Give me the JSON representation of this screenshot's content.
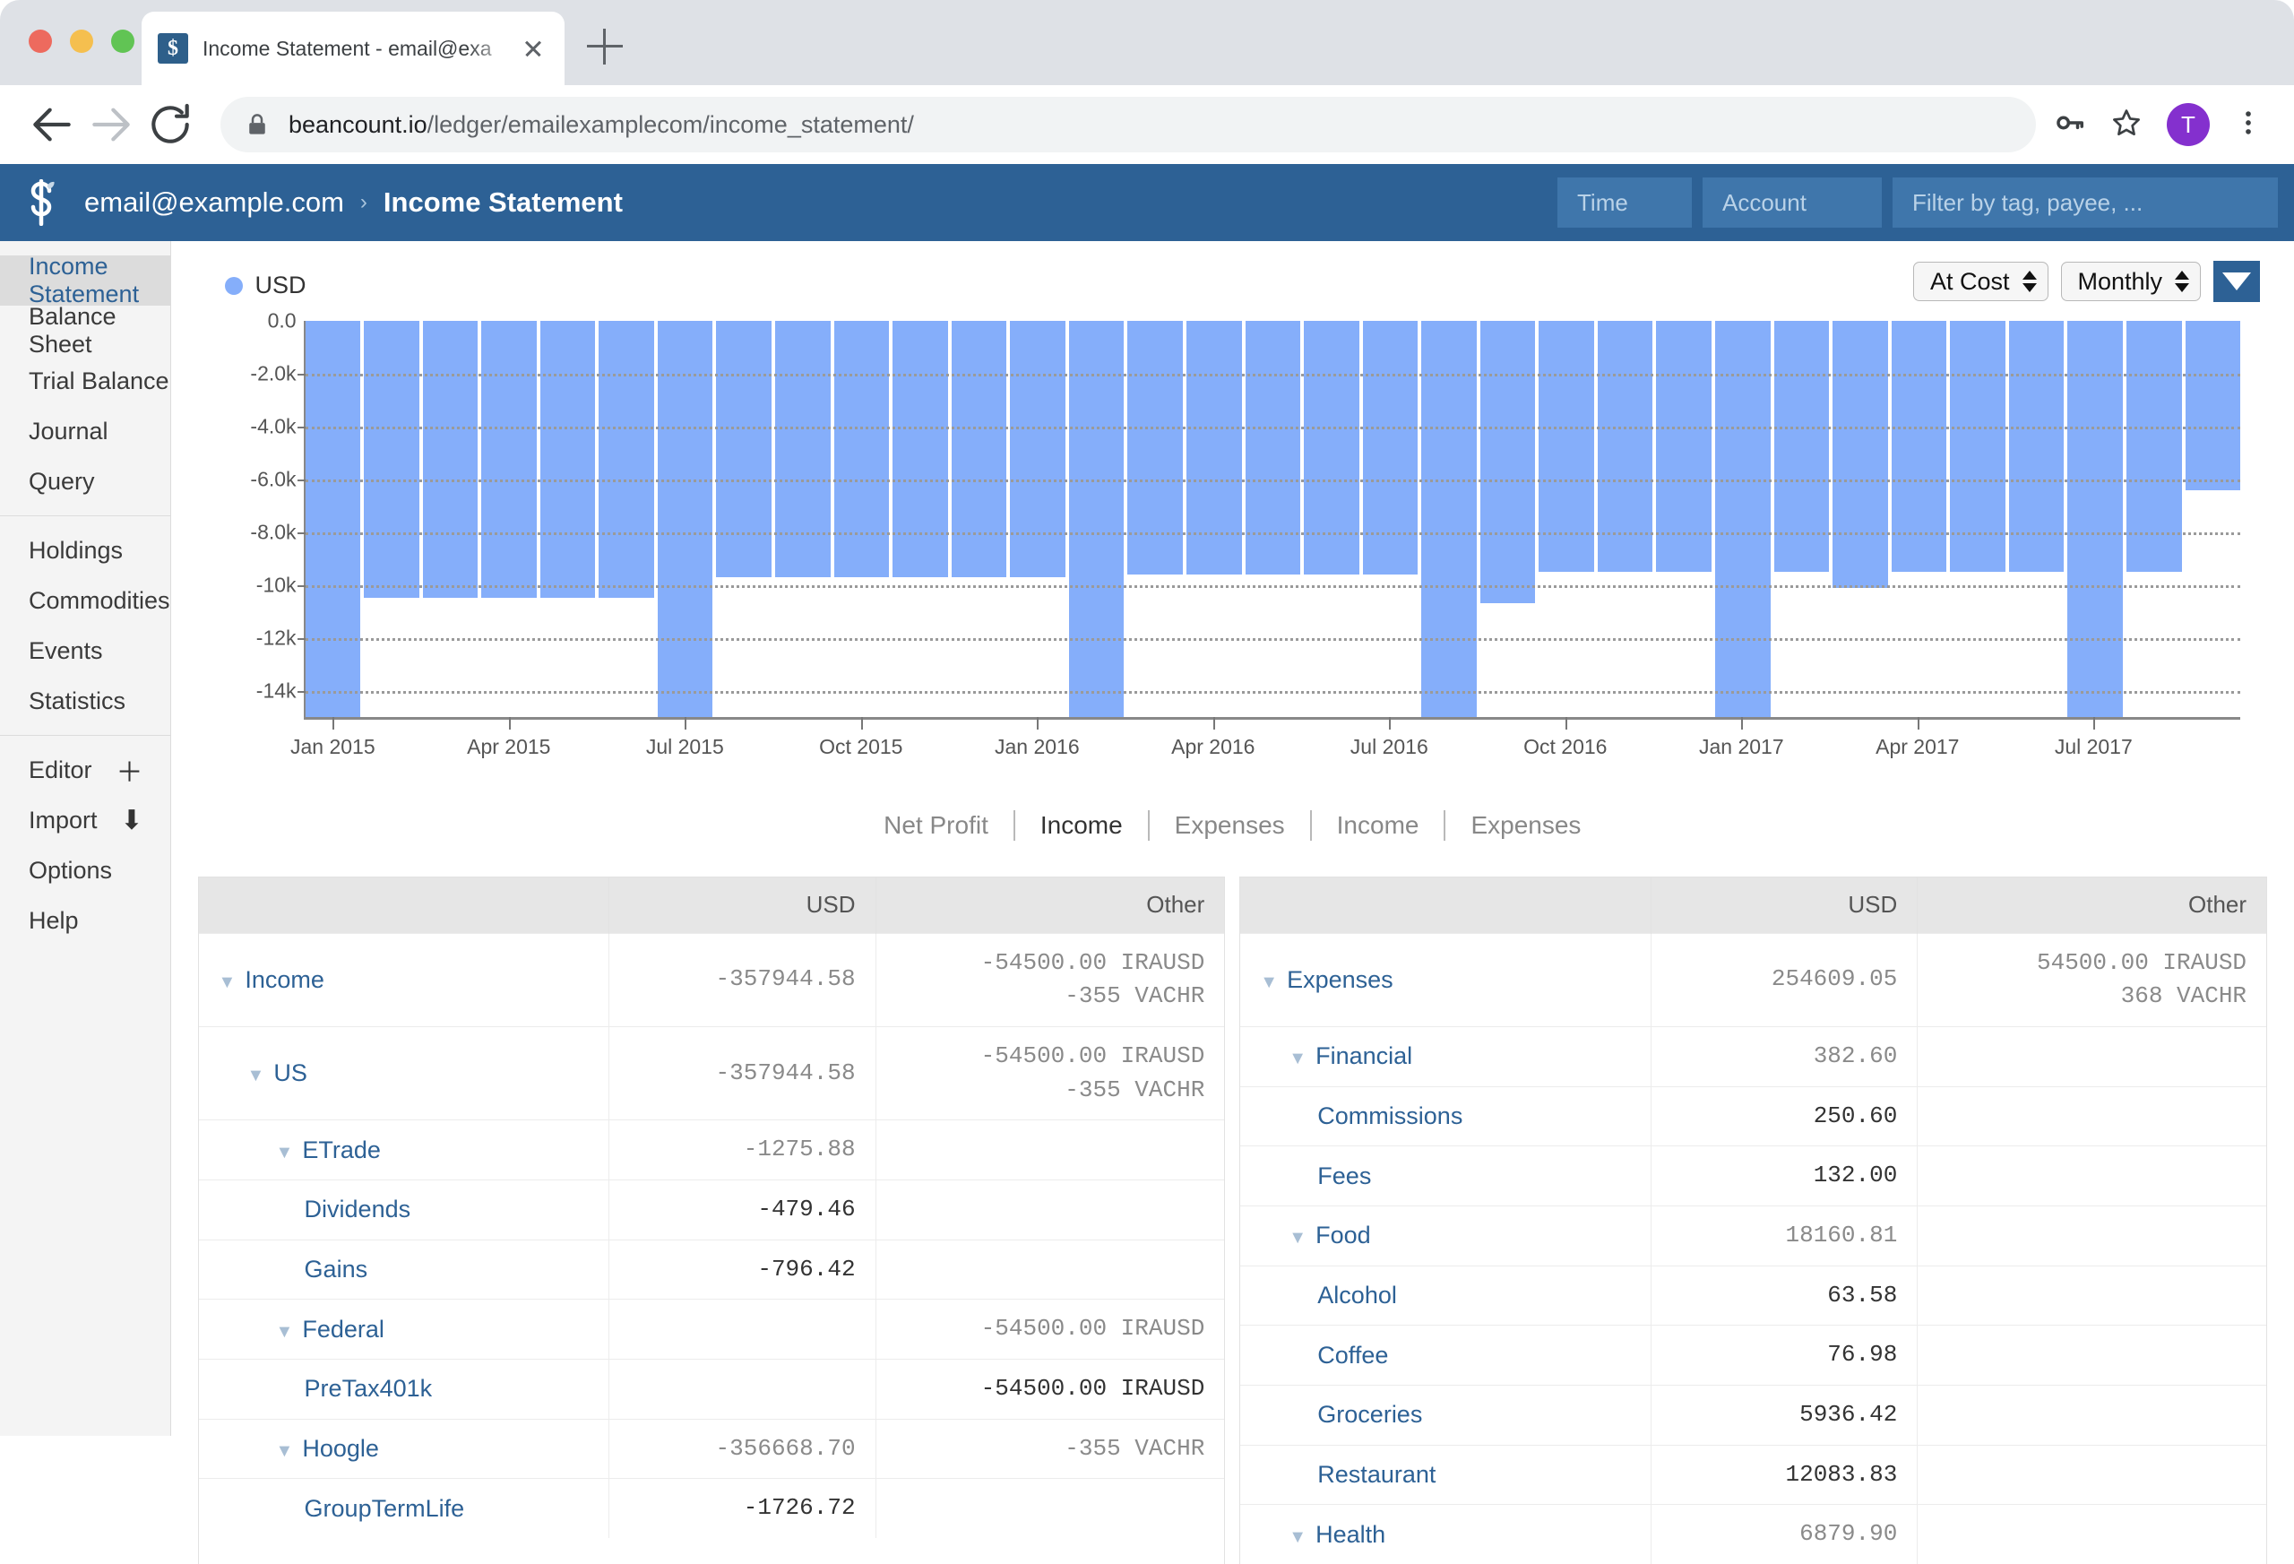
{
  "browser": {
    "tab_title": "Income Statement - email@exa",
    "favicon_glyph": "$",
    "url_domain": "beancount.io",
    "url_path": "/ledger/emailexamplecom/income_statement/",
    "avatar_letter": "T"
  },
  "header": {
    "account": "email@example.com",
    "separator": "›",
    "page_title": "Income Statement",
    "filters": {
      "time_placeholder": "Time",
      "account_placeholder": "Account",
      "tag_placeholder": "Filter by tag, payee, ..."
    }
  },
  "sidebar": {
    "group1": [
      {
        "label": "Income Statement",
        "active": true
      },
      {
        "label": "Balance Sheet",
        "active": false
      },
      {
        "label": "Trial Balance",
        "active": false
      },
      {
        "label": "Journal",
        "active": false
      },
      {
        "label": "Query",
        "active": false
      }
    ],
    "group2": [
      {
        "label": "Holdings"
      },
      {
        "label": "Commodities"
      },
      {
        "label": "Events"
      },
      {
        "label": "Statistics"
      }
    ],
    "group3": [
      {
        "label": "Editor",
        "icon": "plus-icon",
        "glyph": "＋"
      },
      {
        "label": "Import",
        "icon": "download-arrow-icon",
        "glyph": "⬇"
      },
      {
        "label": "Options",
        "icon": "",
        "glyph": ""
      },
      {
        "label": "Help",
        "icon": "",
        "glyph": ""
      }
    ]
  },
  "chart_controls": {
    "conversion": "At Cost",
    "interval": "Monthly",
    "toggle_icon": "chevron-down-icon"
  },
  "chart_tabs": [
    {
      "label": "Net Profit",
      "active": false
    },
    {
      "label": "Income",
      "active": true
    },
    {
      "label": "Expenses",
      "active": false
    },
    {
      "label": "Income",
      "active": false
    },
    {
      "label": "Expenses",
      "active": false
    }
  ],
  "chart_data": {
    "type": "bar",
    "title": "",
    "xlabel": "",
    "ylabel": "",
    "legend": [
      {
        "name": "USD",
        "color": "#85aefa"
      }
    ],
    "legend_position": "top-left",
    "grid": true,
    "ylim": [
      -15000,
      0
    ],
    "yticks": [
      0.0,
      -2000,
      -4000,
      -6000,
      -8000,
      -10000,
      -12000,
      -14000
    ],
    "ytick_labels": [
      "0.0",
      "-2.0k",
      "-4.0k",
      "-6.0k",
      "-8.0k",
      "-10k",
      "-12k",
      "-14k"
    ],
    "xtick_labels": [
      "Jan 2015",
      "Apr 2015",
      "Jul 2015",
      "Oct 2015",
      "Jan 2016",
      "Apr 2016",
      "Jul 2016",
      "Oct 2016",
      "Jan 2017",
      "Apr 2017",
      "Jul 2017"
    ],
    "categories": [
      "Jan 2015",
      "Feb 2015",
      "Mar 2015",
      "Apr 2015",
      "May 2015",
      "Jun 2015",
      "Jul 2015",
      "Aug 2015",
      "Sep 2015",
      "Oct 2015",
      "Nov 2015",
      "Dec 2015",
      "Jan 2016",
      "Feb 2016",
      "Mar 2016",
      "Apr 2016",
      "May 2016",
      "Jun 2016",
      "Jul 2016",
      "Aug 2016",
      "Sep 2016",
      "Oct 2016",
      "Nov 2016",
      "Dec 2016",
      "Jan 2017",
      "Feb 2017",
      "Mar 2017",
      "Apr 2017",
      "May 2017",
      "Jun 2017",
      "Jul 2017",
      "Aug 2017",
      "Sep 2017"
    ],
    "values": [
      -15000,
      -10500,
      -10500,
      -10500,
      -10500,
      -10500,
      -15000,
      -9700,
      -9700,
      -9700,
      -9700,
      -9700,
      -9700,
      -15000,
      -9600,
      -9600,
      -9600,
      -9600,
      -9600,
      -15000,
      -10700,
      -9500,
      -9500,
      -9500,
      -15000,
      -9500,
      -10100,
      -9500,
      -9500,
      -9500,
      -15000,
      -9500,
      -6400
    ]
  },
  "income_table": {
    "columns": [
      "",
      "USD",
      "Other"
    ],
    "rows": [
      {
        "name": "Income",
        "indent": 0,
        "caret": true,
        "usd": "-357944.58",
        "other": "-54500.00 IRAUSD\n-355 VACHR",
        "muted": true
      },
      {
        "name": "US",
        "indent": 1,
        "caret": true,
        "usd": "-357944.58",
        "other": "-54500.00 IRAUSD\n-355 VACHR",
        "muted": true
      },
      {
        "name": "ETrade",
        "indent": 2,
        "caret": true,
        "usd": "-1275.88",
        "other": "",
        "muted": true
      },
      {
        "name": "Dividends",
        "indent": 3,
        "caret": false,
        "usd": "-479.46",
        "other": "",
        "muted": false
      },
      {
        "name": "Gains",
        "indent": 3,
        "caret": false,
        "usd": "-796.42",
        "other": "",
        "muted": false
      },
      {
        "name": "Federal",
        "indent": 2,
        "caret": true,
        "usd": "",
        "other": "-54500.00 IRAUSD",
        "muted": true
      },
      {
        "name": "PreTax401k",
        "indent": 3,
        "caret": false,
        "usd": "",
        "other": "-54500.00 IRAUSD",
        "muted": false
      },
      {
        "name": "Hoogle",
        "indent": 2,
        "caret": true,
        "usd": "-356668.70",
        "other": "-355 VACHR",
        "muted": true
      },
      {
        "name": "GroupTermLife",
        "indent": 3,
        "caret": false,
        "usd": "-1726.72",
        "other": "",
        "muted": false
      }
    ]
  },
  "expenses_table": {
    "columns": [
      "",
      "USD",
      "Other"
    ],
    "rows": [
      {
        "name": "Expenses",
        "indent": 0,
        "caret": true,
        "usd": "254609.05",
        "other": "54500.00 IRAUSD\n368 VACHR",
        "muted": true
      },
      {
        "name": "Financial",
        "indent": 1,
        "caret": true,
        "usd": "382.60",
        "other": "",
        "muted": true
      },
      {
        "name": "Commissions",
        "indent": 2,
        "caret": false,
        "usd": "250.60",
        "other": "",
        "muted": false
      },
      {
        "name": "Fees",
        "indent": 2,
        "caret": false,
        "usd": "132.00",
        "other": "",
        "muted": false
      },
      {
        "name": "Food",
        "indent": 1,
        "caret": true,
        "usd": "18160.81",
        "other": "",
        "muted": true
      },
      {
        "name": "Alcohol",
        "indent": 2,
        "caret": false,
        "usd": "63.58",
        "other": "",
        "muted": false
      },
      {
        "name": "Coffee",
        "indent": 2,
        "caret": false,
        "usd": "76.98",
        "other": "",
        "muted": false
      },
      {
        "name": "Groceries",
        "indent": 2,
        "caret": false,
        "usd": "5936.42",
        "other": "",
        "muted": false
      },
      {
        "name": "Restaurant",
        "indent": 2,
        "caret": false,
        "usd": "12083.83",
        "other": "",
        "muted": false
      },
      {
        "name": "Health",
        "indent": 1,
        "caret": true,
        "usd": "6879.90",
        "other": "",
        "muted": true
      }
    ]
  }
}
